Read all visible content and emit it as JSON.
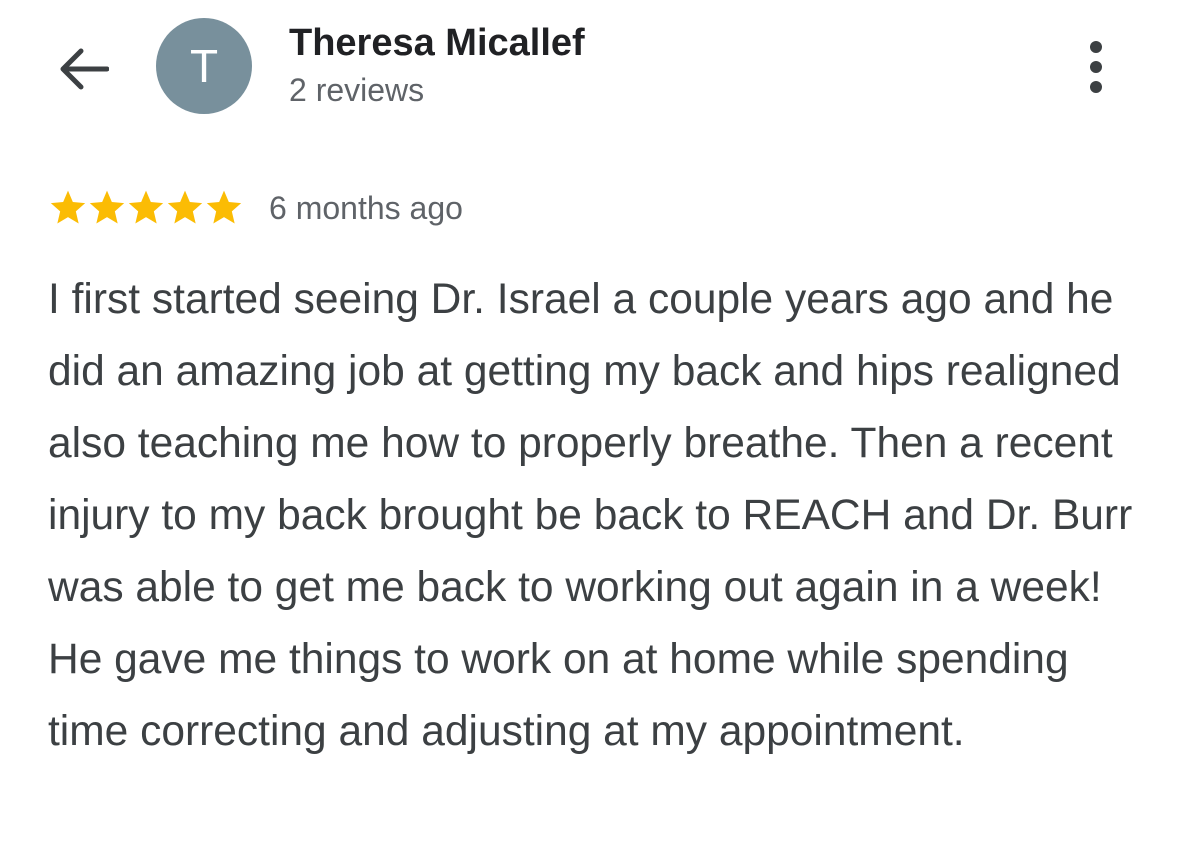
{
  "header": {
    "back_icon": "arrow-left-icon",
    "avatar_initial": "T",
    "user_name": "Theresa Micallef",
    "review_count": "2 reviews",
    "more_icon": "more-vert-icon"
  },
  "review": {
    "rating": 5,
    "rating_max": 5,
    "star_color": "#fbbc04",
    "time_ago": "6 months ago",
    "text": "I first started seeing Dr. Israel a couple years ago and he did an amazing job at getting my back and hips realigned also teaching me how to properly breathe. Then a recent injury to my back brought be back to REACH and Dr. Burr was able to get me back to working out again in a week! He gave me things to work on at home while spending time correcting and adjusting at my appointment."
  },
  "colors": {
    "avatar_bg": "#78909c",
    "text_primary": "#202124",
    "text_body": "#3c4043",
    "text_secondary": "#5f6368"
  }
}
